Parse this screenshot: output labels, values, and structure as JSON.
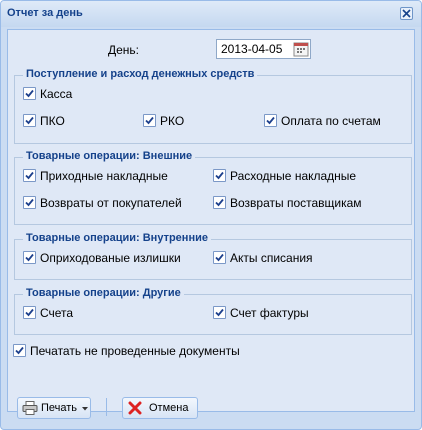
{
  "window": {
    "title": "Отчет за день"
  },
  "date": {
    "label": "День:",
    "value": "2013-04-05"
  },
  "groups": [
    {
      "legend": "Поступление и расход денежных средств",
      "items": [
        "Касса",
        "ПКО",
        "РКО",
        "Оплата по счетам"
      ]
    },
    {
      "legend": "Товарные операции: Внешние",
      "items": [
        "Приходные накладные",
        "Расходные накладные",
        "Возвраты от покупателей",
        "Возвраты поставщикам"
      ]
    },
    {
      "legend": "Товарные операции: Внутренние",
      "items": [
        "Оприходованые излишки",
        "Акты списания"
      ]
    },
    {
      "legend": "Товарные операции: Другие",
      "items": [
        "Счета",
        "Счет фактуры"
      ]
    }
  ],
  "print_unposted": {
    "label": "Печатать не проведенные документы",
    "checked": true
  },
  "buttons": {
    "print": "Печать",
    "cancel": "Отмена"
  }
}
